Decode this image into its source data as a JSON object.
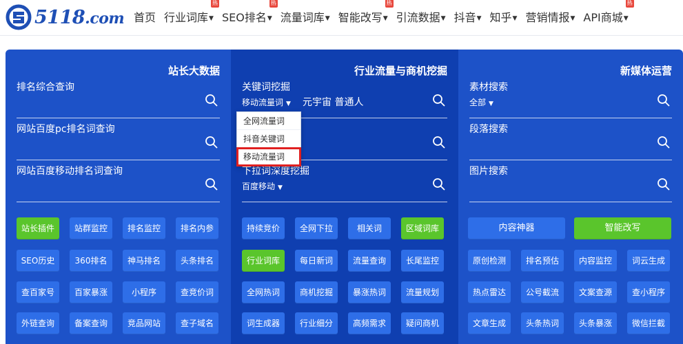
{
  "logo": {
    "text": "5118",
    "suffix": ".com"
  },
  "nav": [
    {
      "label": "首页",
      "caret": "",
      "hot": false
    },
    {
      "label": "行业词库",
      "caret": "▼",
      "hot": true
    },
    {
      "label": "SEO排名",
      "caret": "▼",
      "hot": true
    },
    {
      "label": "流量词库",
      "caret": "▼",
      "hot": false
    },
    {
      "label": "智能改写",
      "caret": "▼",
      "hot": true
    },
    {
      "label": "引流数据",
      "caret": "▼",
      "hot": false
    },
    {
      "label": "抖音",
      "caret": "▼",
      "hot": false
    },
    {
      "label": "知乎",
      "caret": "▼",
      "hot": false
    },
    {
      "label": "营销情报",
      "caret": "▼",
      "hot": false
    },
    {
      "label": "API商城",
      "caret": "▼",
      "hot": true
    }
  ],
  "hot_badge": "热",
  "colors": {
    "panel": "#1d52c8",
    "panel_mid": "#0f3fb0",
    "button": "#2e6ee8",
    "button_active": "#5ac52c",
    "highlight": "#e02020"
  },
  "col_a": {
    "title": "站长大数据",
    "fields": [
      {
        "label": "排名综合查询"
      },
      {
        "label": "网站百度pc排名词查询"
      },
      {
        "label": "网站百度移动排名词查询"
      }
    ]
  },
  "col_b": {
    "title": "行业流量与商机挖掘",
    "keyword_label": "关键词挖掘",
    "keyword_type": "移动流量词",
    "keyword_value": "元宇宙 普通人",
    "field3_label": "下拉词深度挖掘",
    "field3_sub": "百度移动",
    "dropdown": [
      "全网流量词",
      "抖音关键词",
      "移动流量词"
    ]
  },
  "col_c": {
    "title": "新媒体运营",
    "field1_label": "素材搜索",
    "field1_sub": "全部",
    "field2_label": "段落搜索",
    "field3_label": "图片搜索"
  },
  "buttons_a": [
    [
      "站长插件",
      "站群监控",
      "排名监控",
      "排名内参"
    ],
    [
      "SEO历史",
      "360排名",
      "神马排名",
      "头条排名"
    ],
    [
      "查百家号",
      "百家暴涨",
      "小程序",
      "查竞价词"
    ],
    [
      "外链查询",
      "备案查询",
      "竞品网站",
      "查子域名"
    ]
  ],
  "buttons_b": [
    [
      "持续竞价",
      "全网下拉",
      "相关词",
      "区域词库"
    ],
    [
      "行业词库",
      "每日新词",
      "流量查询",
      "长尾监控"
    ],
    [
      "全网热词",
      "商机挖掘",
      "暴涨热词",
      "流量规划"
    ],
    [
      "词生成器",
      "行业细分",
      "高频需求",
      "疑问商机"
    ]
  ],
  "buttons_c_top": [
    "内容神器",
    "智能改写"
  ],
  "buttons_c": [
    [
      "原创检测",
      "排名预估",
      "内容监控",
      "词云生成"
    ],
    [
      "热点雷达",
      "公号截流",
      "文案查源",
      "查小程序"
    ],
    [
      "文章生成",
      "头条热词",
      "头条暴涨",
      "微信拦截"
    ]
  ]
}
